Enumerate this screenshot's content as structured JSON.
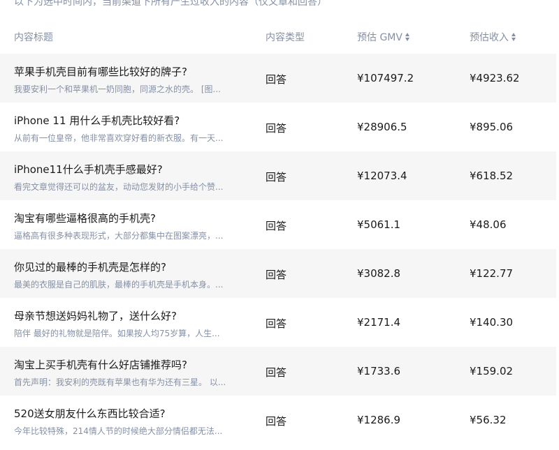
{
  "notice": "以下为选中时间内，当前渠道下所有产生过收入的内容（仅文章和回答）",
  "table": {
    "headers": {
      "title": "内容标题",
      "type": "内容类型",
      "gmv": "预估 GMV",
      "income": "预估收入"
    },
    "rows": [
      {
        "title": "苹果手机壳目前有哪些比较好的牌子?",
        "excerpt": "我要安利一个和苹果机一奶同胞，同源之水的壳。 [图...",
        "type": "回答",
        "gmv": "¥107497.2",
        "income": "¥4923.62"
      },
      {
        "title": "iPhone 11 用什么手机壳比较好看?",
        "excerpt": "从前有一位皇帝，他非常喜欢穿好看的新衣服。有一天...",
        "type": "回答",
        "gmv": "¥28906.5",
        "income": "¥895.06"
      },
      {
        "title": "iPhone11什么手机壳手感最好?",
        "excerpt": "看完文章觉得还可以的盆友，动动您发财的小手给个赞...",
        "type": "回答",
        "gmv": "¥12073.4",
        "income": "¥618.52"
      },
      {
        "title": "淘宝有哪些逼格很高的手机壳?",
        "excerpt": "逼格高有很多种表现形式，大部分都集中在图案漂亮，...",
        "type": "回答",
        "gmv": "¥5061.1",
        "income": "¥48.06"
      },
      {
        "title": "你见过的最棒的手机壳是怎样的?",
        "excerpt": "最美的衣服是自己的肌肤，最棒的手机壳是手机本身。...",
        "type": "回答",
        "gmv": "¥3082.8",
        "income": "¥122.77"
      },
      {
        "title": "母亲节想送妈妈礼物了，送什么好?",
        "excerpt": "陪伴 最好的礼物就是陪伴。如果按人均75岁算，人生...",
        "type": "回答",
        "gmv": "¥2171.4",
        "income": "¥140.30"
      },
      {
        "title": "淘宝上买手机壳有什么好店铺推荐吗?",
        "excerpt": "首先声明：我安利的壳既有苹果也有华为还有三星。 以...",
        "type": "回答",
        "gmv": "¥1733.6",
        "income": "¥159.02"
      },
      {
        "title": "520送女朋友什么东西比较合适?",
        "excerpt": "今年比较特殊，214情人节的时候绝大部分情侣都无法...",
        "type": "回答",
        "gmv": "¥1286.9",
        "income": "¥56.32"
      }
    ]
  }
}
